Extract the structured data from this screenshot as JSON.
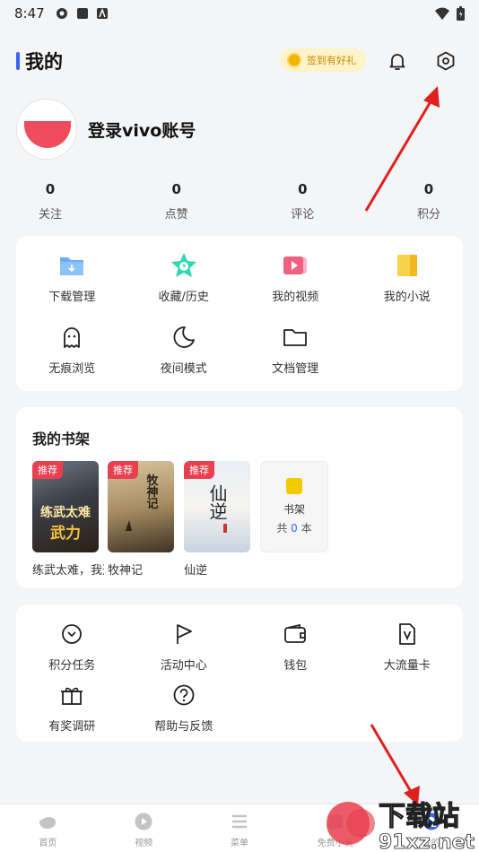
{
  "status_bar": {
    "time": "8:47"
  },
  "header": {
    "title": "我的",
    "checkin_label": "签到有好礼"
  },
  "profile": {
    "login_label": "登录vivo账号"
  },
  "stats": [
    {
      "value": "0",
      "label": "关注"
    },
    {
      "value": "0",
      "label": "点赞"
    },
    {
      "value": "0",
      "label": "评论"
    },
    {
      "value": "0",
      "label": "积分"
    }
  ],
  "tools": [
    {
      "label": "下载管理",
      "icon": "download-folder-icon"
    },
    {
      "label": "收藏/历史",
      "icon": "star-clock-icon"
    },
    {
      "label": "我的视频",
      "icon": "video-icon"
    },
    {
      "label": "我的小说",
      "icon": "book-icon"
    },
    {
      "label": "无痕浏览",
      "icon": "ghost-icon"
    },
    {
      "label": "夜间模式",
      "icon": "moon-icon"
    },
    {
      "label": "文档管理",
      "icon": "folder-icon"
    }
  ],
  "bookshelf": {
    "title": "我的书架",
    "badge": "推荐",
    "books": [
      {
        "name": "练武太难，我选择",
        "cover_text": "练武太难"
      },
      {
        "name": "牧神记",
        "cover_text": "牧神记"
      },
      {
        "name": "仙逆",
        "cover_text": "仙逆"
      }
    ],
    "shelf_label": "书架",
    "shelf_count_prefix": "共",
    "shelf_count": "0",
    "shelf_count_suffix": "本"
  },
  "services": [
    {
      "label": "积分任务",
      "icon": "chevron-circle-icon"
    },
    {
      "label": "活动中心",
      "icon": "flag-icon"
    },
    {
      "label": "钱包",
      "icon": "wallet-icon"
    },
    {
      "label": "大流量卡",
      "icon": "sim-card-icon"
    },
    {
      "label": "有奖调研",
      "icon": "gift-icon"
    },
    {
      "label": "帮助与反馈",
      "icon": "help-icon"
    }
  ],
  "bottom_nav": [
    {
      "label": "首页",
      "icon": "home-icon"
    },
    {
      "label": "视频",
      "icon": "play-icon"
    },
    {
      "label": "菜单",
      "icon": "menu-icon"
    },
    {
      "label": "免费小说",
      "icon": "novel-icon"
    },
    {
      "label": "我的",
      "icon": "profile-icon"
    }
  ],
  "watermark": {
    "text1": "下载站",
    "text2": "91xz.net"
  },
  "colors": {
    "accent": "#3a63f5",
    "badge": "#e8404e",
    "avatar": "#ef4d5e",
    "arrow": "#e01f1f"
  }
}
